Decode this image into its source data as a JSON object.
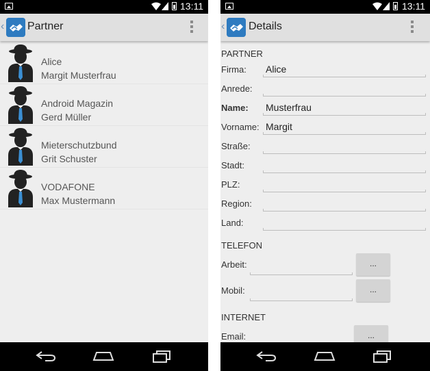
{
  "status_bar": {
    "time": "13:11"
  },
  "left_screen": {
    "title": "Partner",
    "partners": [
      {
        "company": "Alice",
        "name": "Margit Musterfrau"
      },
      {
        "company": "Android Magazin",
        "name": "Gerd Müller"
      },
      {
        "company": "Mieterschutzbund",
        "name": "Grit Schuster"
      },
      {
        "company": "VODAFONE",
        "name": "Max Mustermann"
      }
    ]
  },
  "right_screen": {
    "title": "Details",
    "partner_section": "PARTNER",
    "fields": {
      "firma": {
        "label": "Firma:",
        "value": "Alice"
      },
      "anrede": {
        "label": "Anrede:",
        "value": ""
      },
      "name": {
        "label": "Name:",
        "value": "Musterfrau"
      },
      "vorname": {
        "label": "Vorname:",
        "value": "Margit"
      },
      "strasse": {
        "label": "Straße:",
        "value": ""
      },
      "stadt": {
        "label": "Stadt:",
        "value": ""
      },
      "plz": {
        "label": "PLZ:",
        "value": ""
      },
      "region": {
        "label": "Region:",
        "value": ""
      },
      "land": {
        "label": "Land:",
        "value": ""
      }
    },
    "telefon_section": "TELEFON",
    "phones": {
      "arbeit": {
        "label": "Arbeit:",
        "value": "",
        "button": "..."
      },
      "mobil": {
        "label": "Mobil:",
        "value": "",
        "button": "..."
      }
    },
    "internet_section": "INTERNET",
    "email": {
      "label": "Email:",
      "value": "",
      "button": "..."
    }
  },
  "colors": {
    "accent": "#2e7bc0",
    "background": "#eeeeee",
    "actionbar": "#e0e0e0"
  },
  "icons": [
    "gallery-icon",
    "wifi-icon",
    "signal-icon",
    "battery-icon",
    "app-logo-icon",
    "overflow-menu-icon",
    "person-bowler-hat-icon",
    "back-icon",
    "home-icon",
    "recent-apps-icon"
  ]
}
